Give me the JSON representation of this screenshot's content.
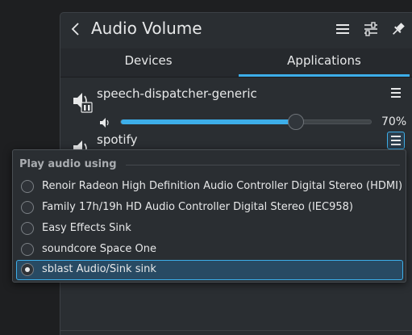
{
  "header": {
    "title": "Audio Volume"
  },
  "tabs": [
    {
      "label": "Devices",
      "active": false
    },
    {
      "label": "Applications",
      "active": true
    }
  ],
  "streams": [
    {
      "name": "speech-dispatcher-generic",
      "volume_percent": "70%",
      "volume_value": 0.7
    },
    {
      "name": "spotify"
    }
  ],
  "popup": {
    "header": "Play audio using",
    "options": [
      {
        "label": "Renoir Radeon High Definition Audio Controller Digital Stereo (HDMI)",
        "checked": false
      },
      {
        "label": "Family 17h/19h HD Audio Controller Digital Stereo (IEC958)",
        "checked": false
      },
      {
        "label": "Easy Effects Sink",
        "checked": false
      },
      {
        "label": "soundcore Space One",
        "checked": false
      },
      {
        "label": "sblast Audio/Sink sink",
        "checked": true
      }
    ]
  },
  "colors": {
    "accent": "#3daee9",
    "background": "#2a2e32",
    "text": "#e7e8e9"
  }
}
